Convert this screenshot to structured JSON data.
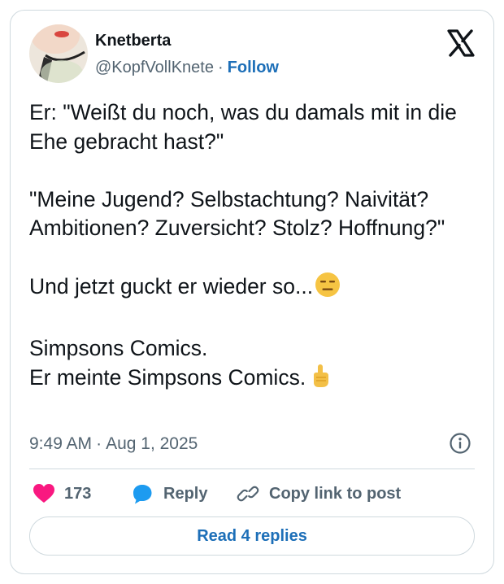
{
  "author": {
    "name": "Knetberta",
    "handle": "@KopfVollKnete",
    "separator": "·",
    "follow_label": "Follow"
  },
  "tweet": {
    "lines": [
      "Er: \"Weißt du noch, was du damals mit in die Ehe gebracht hast?\"",
      "\"Meine Jugend? Selbstachtung? Naivität? Ambitionen? Zuversicht? Stolz? Hoffnung?\"",
      "Und jetzt guckt er wieder so...",
      "Simpsons Comics.",
      "Er meinte Simpsons Comics."
    ],
    "emojis": [
      "expressionless-face",
      "pointing-up-hand"
    ]
  },
  "meta": {
    "time": "9:49 AM",
    "separator": "·",
    "date": "Aug 1, 2025"
  },
  "actions": {
    "like_count": "173",
    "reply_label": "Reply",
    "copy_link_label": "Copy link to post"
  },
  "read_replies_label": "Read 4 replies",
  "colors": {
    "like": "#f91880",
    "reply": "#1d9bf0",
    "link": "#1d6fb8",
    "secondary_text": "#536471",
    "border": "#cfd9de"
  },
  "icons": [
    "x-logo-icon",
    "info-icon",
    "heart-icon",
    "reply-bubble-icon",
    "link-icon"
  ]
}
